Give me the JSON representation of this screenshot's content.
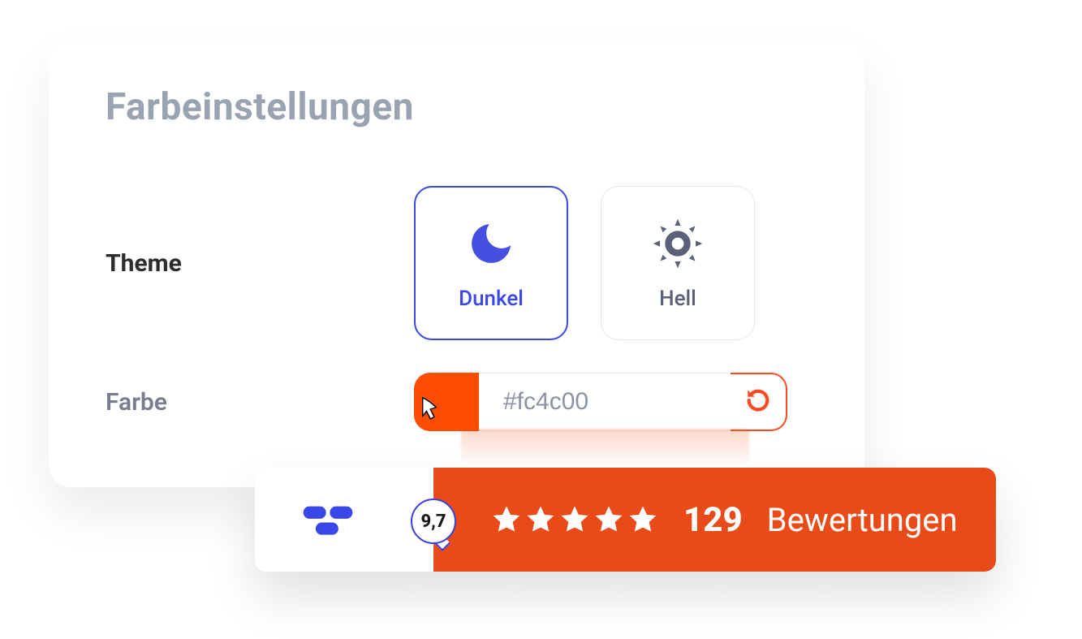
{
  "settings": {
    "title": "Farbeinstellungen",
    "theme_label": "Theme",
    "themes": {
      "dark": {
        "label": "Dunkel"
      },
      "light": {
        "label": "Hell"
      }
    },
    "color_label": "Farbe",
    "color_value": "#fc4c00"
  },
  "rating": {
    "score": "9,7",
    "stars": 5,
    "count": "129",
    "label": "Bewertungen"
  },
  "colors": {
    "accent": "#fc4c00",
    "primary": "#3a47e8",
    "rating_bg": "#e94b18"
  }
}
